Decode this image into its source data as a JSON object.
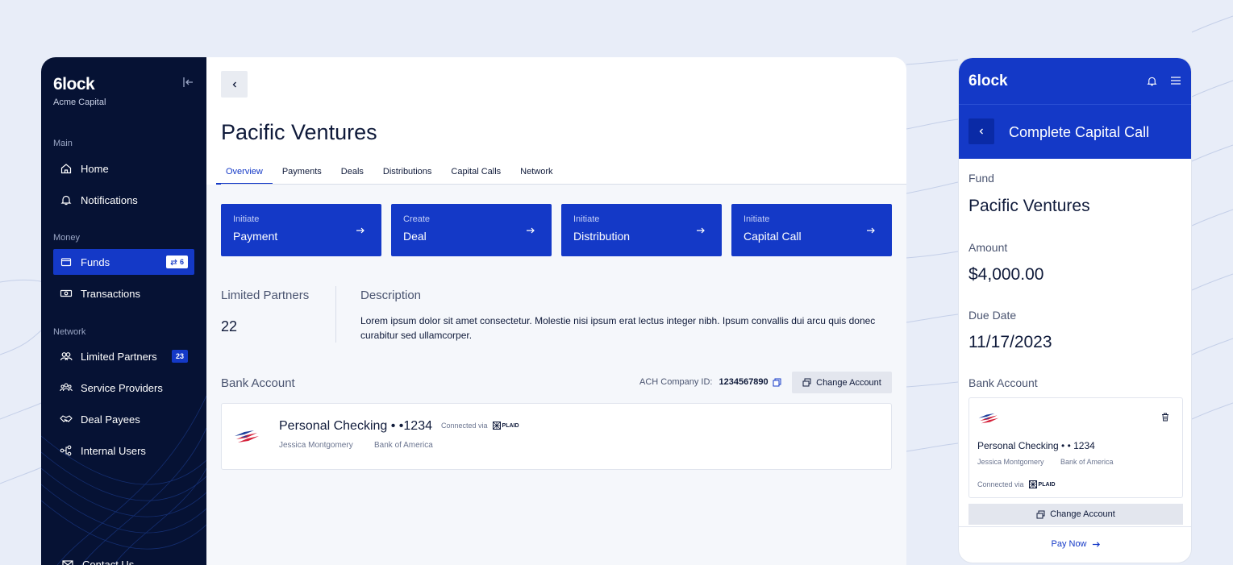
{
  "colors": {
    "primary": "#1439c7",
    "sidebar": "#061234",
    "background": "#e8edf8"
  },
  "sidebar": {
    "brand": "6lock",
    "org": "Acme Capital",
    "sections": {
      "main": "Main",
      "money": "Money",
      "network": "Network"
    },
    "items": {
      "home": "Home",
      "notifications": "Notifications",
      "funds": "Funds",
      "funds_badge": "6",
      "transactions": "Transactions",
      "limited_partners": "Limited Partners",
      "limited_partners_badge": "23",
      "service_providers": "Service Providers",
      "deal_payees": "Deal Payees",
      "internal_users": "Internal Users",
      "contact": "Contact Us"
    }
  },
  "main": {
    "title": "Pacific Ventures",
    "tabs": [
      "Overview",
      "Payments",
      "Deals",
      "Distributions",
      "Capital Calls",
      "Network"
    ],
    "actions": [
      {
        "small": "Initiate",
        "big": "Payment"
      },
      {
        "small": "Create",
        "big": "Deal"
      },
      {
        "small": "Initiate",
        "big": "Distribution"
      },
      {
        "small": "Initiate",
        "big": "Capital Call"
      }
    ],
    "limited_partners_label": "Limited Partners",
    "limited_partners_value": "22",
    "description_label": "Description",
    "description_text": "Lorem ipsum dolor sit amet consectetur. Molestie nisi ipsum erat lectus integer nibh. Ipsum convallis dui arcu quis donec curabitur sed ullamcorper.",
    "bank_account_label": "Bank Account",
    "ach_label": "ACH Company ID:",
    "ach_value": "1234567890",
    "change_account": "Change Account",
    "account_name": "Personal Checking • •1234",
    "connected_via": "Connected via",
    "plaid": "PLAID",
    "account_holder": "Jessica Montgomery",
    "bank_name": "Bank of America"
  },
  "mobile": {
    "brand": "6lock",
    "title": "Complete Capital Call",
    "fund_label": "Fund",
    "fund_value": "Pacific Ventures",
    "amount_label": "Amount",
    "amount_value": "$4,000.00",
    "due_label": "Due Date",
    "due_value": "11/17/2023",
    "bank_label": "Bank Account",
    "account_name": "Personal Checking • • 1234",
    "account_holder": "Jessica Montgomery",
    "bank_name": "Bank of America",
    "connected_via": "Connected via",
    "plaid": "PLAID",
    "change_account": "Change Account",
    "pay_now": "Pay Now"
  }
}
